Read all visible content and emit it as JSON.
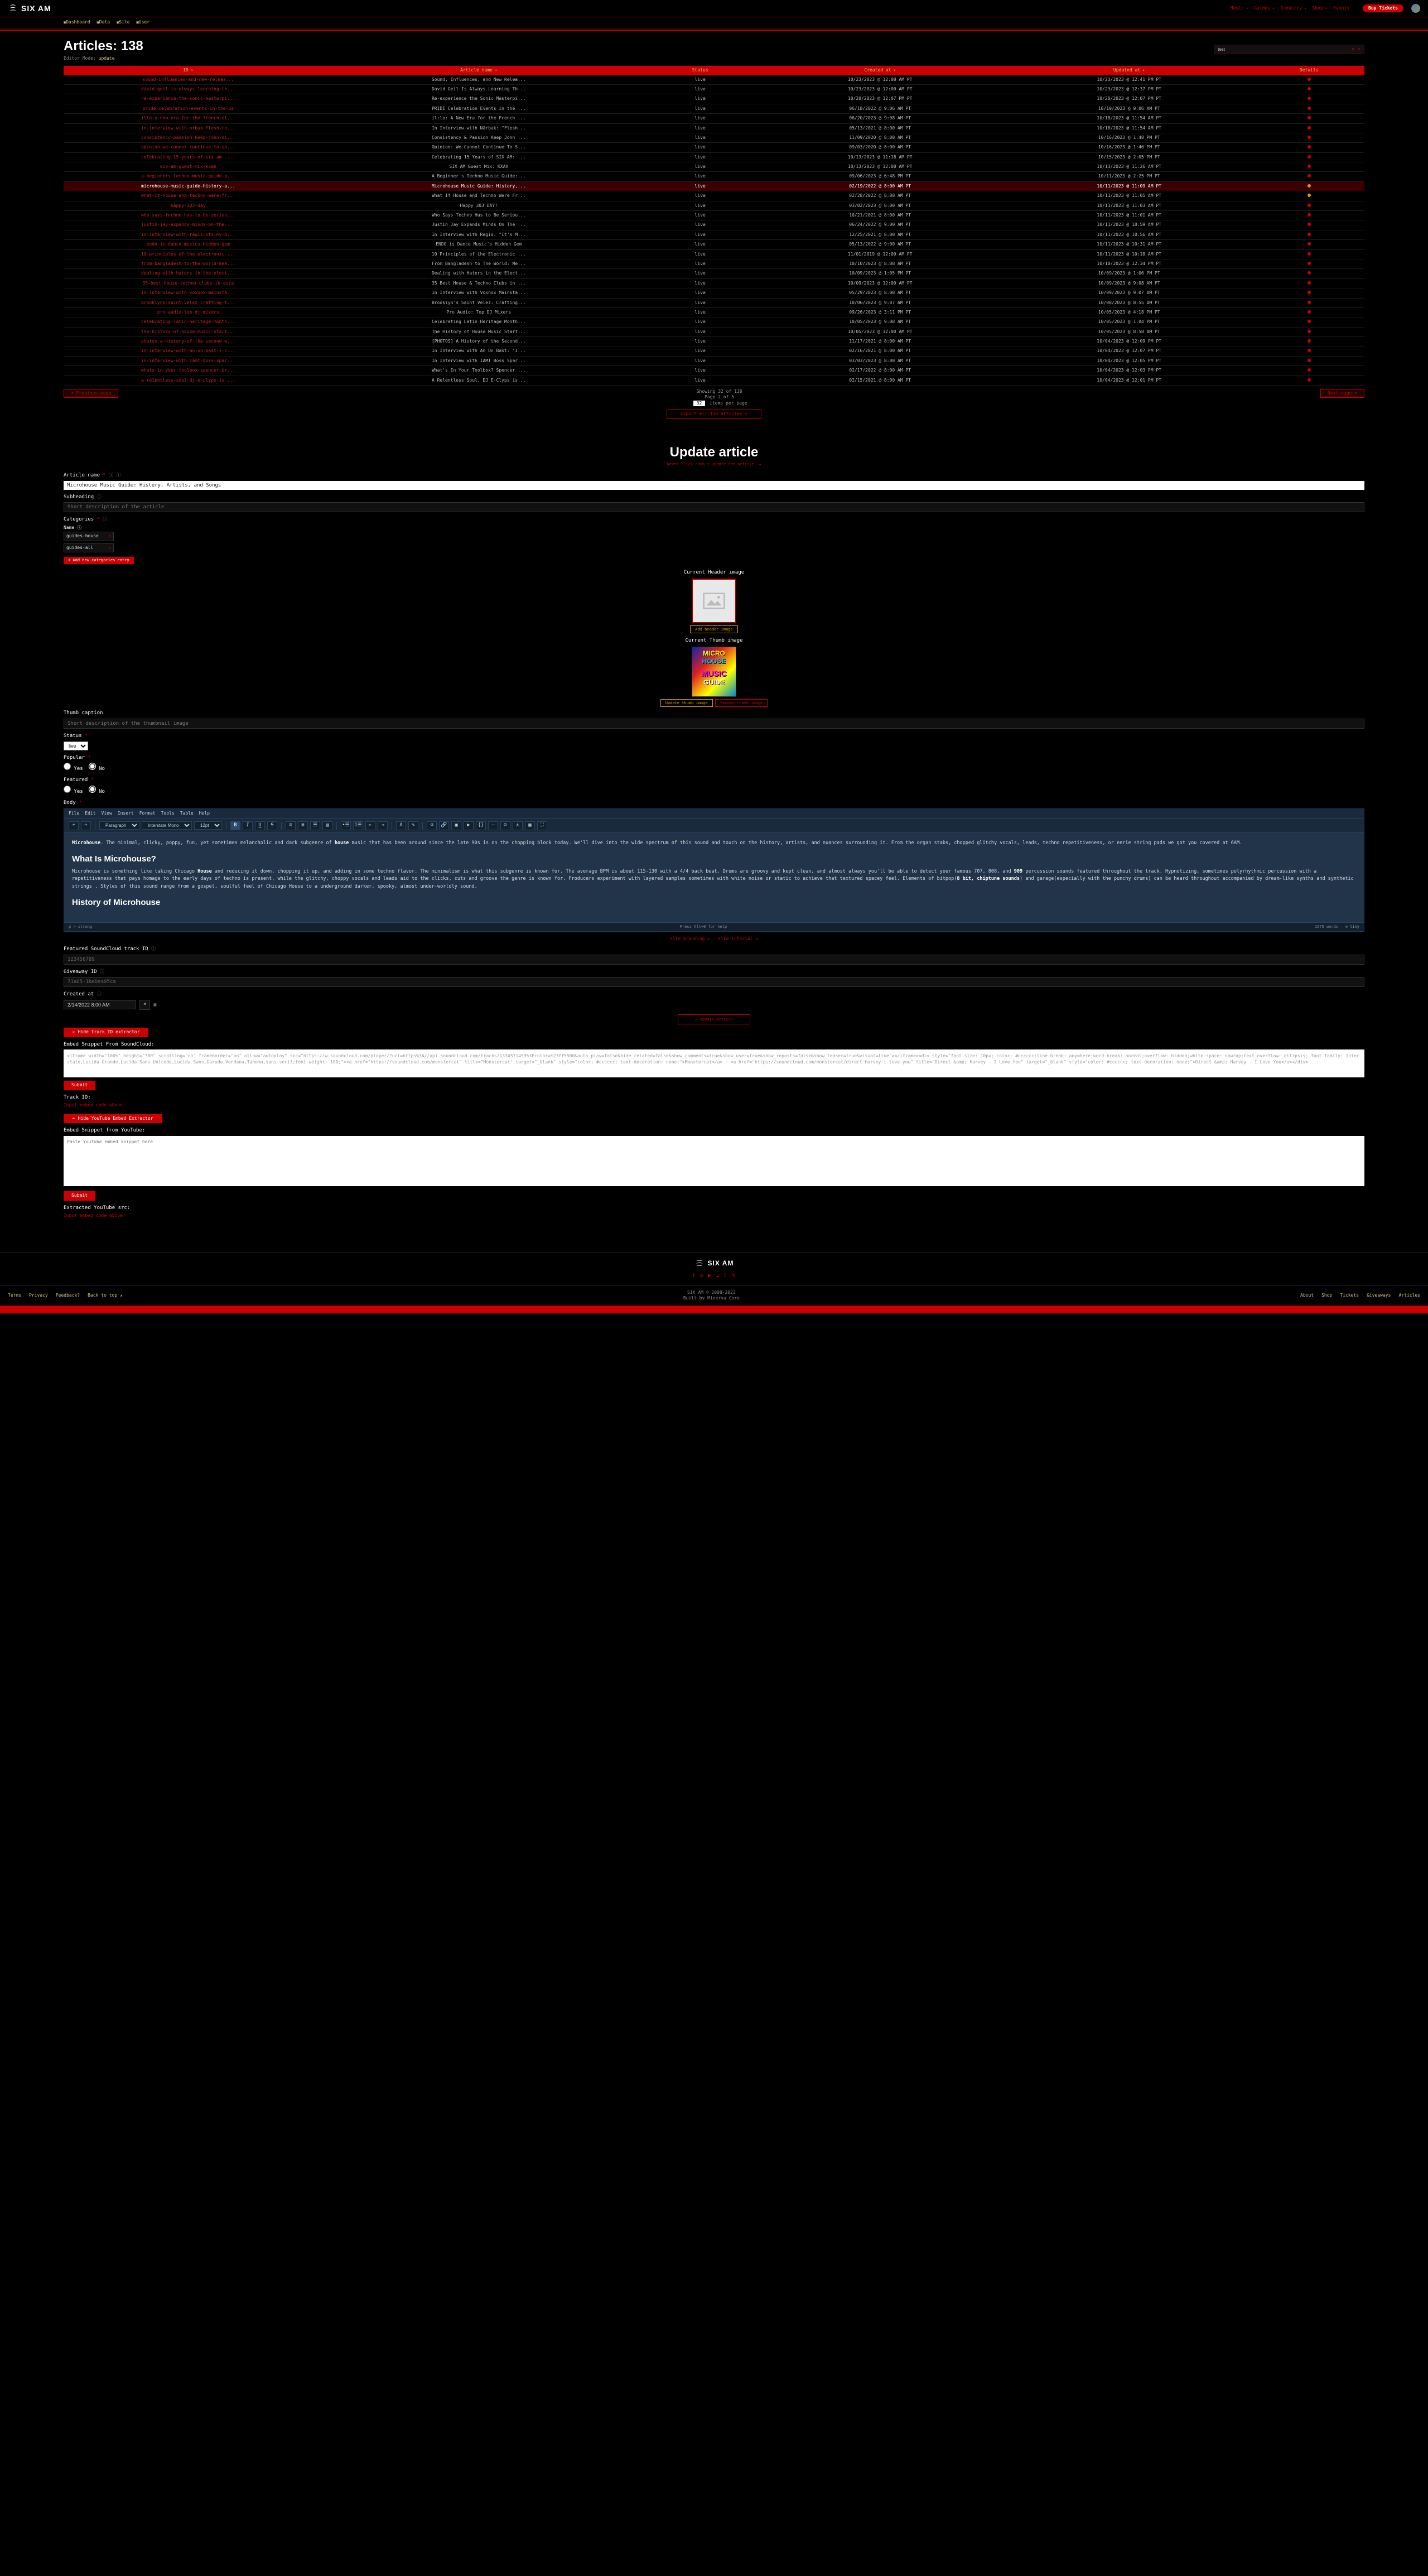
{
  "brand": "SIX AM",
  "topnav": {
    "links": [
      "Music",
      "Guides",
      "Industry",
      "Shop",
      "Events"
    ],
    "buy": "Buy Tickets"
  },
  "subnav": [
    "Dashboard",
    "Data",
    "Site",
    "User"
  ],
  "page": {
    "title": "Articles: 138",
    "editor_mode_label": "Editor Mode:",
    "editor_mode_value": "update",
    "search_value": "test"
  },
  "table": {
    "headers": [
      "ID",
      "Article name",
      "Status",
      "Created at",
      "Updated at",
      "Details"
    ],
    "rows": [
      {
        "id": "sound-influences-and-new-releas...",
        "name": "Sound, Influences, and New Relea...",
        "status": "live",
        "created": "10/23/2023 @ 12:08 AM PT",
        "updated": "10/23/2023 @ 12:41 PM PT",
        "hl": false,
        "dot": "red"
      },
      {
        "id": "david-geil-is-always-learning-th...",
        "name": "David Geil Is Always Learning Th...",
        "status": "live",
        "created": "10/23/2023 @ 12:00 AM PT",
        "updated": "10/23/2023 @ 12:37 PM PT",
        "hl": false,
        "dot": "red"
      },
      {
        "id": "re-experience-the-sonic-masterpi...",
        "name": "Re-experience the Sonic Masterpi...",
        "status": "live",
        "created": "10/20/2023 @ 12:07 PM PT",
        "updated": "10/20/2023 @ 12:07 PM PT",
        "hl": false,
        "dot": "red"
      },
      {
        "id": "pride-celebration-events-in-the-us",
        "name": "PRIDE Celebration Events in the ...",
        "status": "live",
        "created": "06/18/2022 @ 9:06 AM PT",
        "updated": "10/19/2023 @ 9:06 AM PT",
        "hl": false,
        "dot": "red"
      },
      {
        "id": "illo-a-new-era-for-the-french-el...",
        "name": "il:lo: A New Era for the French ...",
        "status": "live",
        "created": "06/20/2023 @ 9:08 AM PT",
        "updated": "10/18/2023 @ 11:54 AM PT",
        "hl": false,
        "dot": "red"
      },
      {
        "id": "in-interview-with-orbak-flesh-to...",
        "name": "In Interview with Närbak: \"Flesh...",
        "status": "live",
        "created": "05/13/2021 @ 8:00 AM PT",
        "updated": "10/18/2023 @ 11:54 AM PT",
        "hl": false,
        "dot": "red"
      },
      {
        "id": "consistency-passion-keep-john-di...",
        "name": "Consistency & Passion Keep John ...",
        "status": "live",
        "created": "11/09/2020 @ 8:00 AM PT",
        "updated": "10/16/2023 @ 1:48 PM PT",
        "hl": false,
        "dot": "red"
      },
      {
        "id": "opinion-we-cannot-continue-to-sa...",
        "name": "Opinion: We Cannot Continue To S...",
        "status": "live",
        "created": "09/03/2020 @ 8:00 AM PT",
        "updated": "10/16/2023 @ 1:46 PM PT",
        "hl": false,
        "dot": "red"
      },
      {
        "id": "celebrating-15-years-of-six-am--...",
        "name": "Celebrating 15 Years of SIX AM: ...",
        "status": "live",
        "created": "10/13/2023 @ 11:18 AM PT",
        "updated": "10/15/2023 @ 2:05 PM PT",
        "hl": false,
        "dot": "red"
      },
      {
        "id": "six-am-guest-mix-kxah",
        "name": "SIX AM Guest Mix: KXAH",
        "status": "live",
        "created": "10/13/2023 @ 12:08 AM PT",
        "updated": "10/13/2023 @ 11:26 AM PT",
        "hl": false,
        "dot": "red"
      },
      {
        "id": "a-beginners-techno-music-guide-b...",
        "name": "A Beginner's Techno Music Guide:...",
        "status": "live",
        "created": "09/06/2023 @ 6:48 PM PT",
        "updated": "10/11/2023 @ 2:25 PM PT",
        "hl": false,
        "dot": "red"
      },
      {
        "id": "microhouse-music-guide-history-a...",
        "name": "Microhouse Music Guide: History,...",
        "status": "live",
        "created": "02/19/2022 @ 8:00 AM PT",
        "updated": "10/11/2023 @ 11:09 AM PT",
        "hl": true,
        "dot": "amber"
      },
      {
        "id": "what-if-house-and-techno-were-fr...",
        "name": "What If House and Techno Were Fr...",
        "status": "live",
        "created": "02/28/2022 @ 8:00 AM PT",
        "updated": "10/11/2023 @ 11:05 AM PT",
        "hl": false,
        "dot": "amber"
      },
      {
        "id": "happy-303-day",
        "name": "Happy 303 DAY!",
        "status": "live",
        "created": "03/02/2023 @ 8:00 AM PT",
        "updated": "10/11/2023 @ 11:03 AM PT",
        "hl": false,
        "dot": "red"
      },
      {
        "id": "who-says-techno-has-to-be-seriou...",
        "name": "Who Says Techno Has to Be Seriou...",
        "status": "live",
        "created": "10/21/2021 @ 8:00 AM PT",
        "updated": "10/11/2023 @ 11:01 AM PT",
        "hl": false,
        "dot": "red"
      },
      {
        "id": "justin-jay-expands-minds-on-the-...",
        "name": "Justin Jay Expands Minds On The ...",
        "status": "live",
        "created": "06/24/2022 @ 9:00 AM PT",
        "updated": "10/11/2023 @ 10:59 AM PT",
        "hl": false,
        "dot": "red"
      },
      {
        "id": "in-interview-with-regis-its-my-d...",
        "name": "In Interview with Regis: \"It's M...",
        "status": "live",
        "created": "12/25/2021 @ 8:00 AM PT",
        "updated": "10/11/2023 @ 10:56 AM PT",
        "hl": false,
        "dot": "red"
      },
      {
        "id": "endo-is-dance-musics-hidden-gem",
        "name": "ENDO is Dance Music's Hidden Gem",
        "status": "live",
        "created": "05/13/2022 @ 9:00 AM PT",
        "updated": "10/11/2023 @ 10:31 AM PT",
        "hl": false,
        "dot": "red"
      },
      {
        "id": "10-principles-of-the-electronic-...",
        "name": "10 Principles of the Electronic ...",
        "status": "live",
        "created": "11/01/2019 @ 12:00 AM PT",
        "updated": "10/11/2023 @ 10:18 AM PT",
        "hl": false,
        "dot": "red"
      },
      {
        "id": "from-bangladesh-to-the-world-mee...",
        "name": "From Bangladesh to The World: Me...",
        "status": "live",
        "created": "10/10/2023 @ 8:08 AM PT",
        "updated": "10/10/2023 @ 12:34 PM PT",
        "hl": false,
        "dot": "red"
      },
      {
        "id": "dealing-with-haters-in-the-elect...",
        "name": "Dealing with Haters in the Elect...",
        "status": "live",
        "created": "10/09/2023 @ 1:05 PM PT",
        "updated": "10/09/2023 @ 1:06 PM PT",
        "hl": false,
        "dot": "red"
      },
      {
        "id": "35-best-house-techno-clubs-in-asia",
        "name": "35 Best House & Techno Clubs in ...",
        "status": "live",
        "created": "10/09/2023 @ 12:00 AM PT",
        "updated": "10/09/2023 @ 9:08 AM PT",
        "hl": false,
        "dot": "red"
      },
      {
        "id": "in-interview-with-voxnox-mainsta...",
        "name": "In Interview with Voxnox Mainsta...",
        "status": "live",
        "created": "05/29/2023 @ 8:08 AM PT",
        "updated": "10/09/2023 @ 9:07 AM PT",
        "hl": false,
        "dot": "red"
      },
      {
        "id": "brooklyns-saint-velez-crafting-t...",
        "name": "Brooklyn's Saint Velez: Crafting...",
        "status": "live",
        "created": "10/06/2023 @ 9:07 AM PT",
        "updated": "10/08/2023 @ 8:55 AM PT",
        "hl": false,
        "dot": "red"
      },
      {
        "id": "pro-audio-top-dj-mixers",
        "name": "Pro Audio: Top DJ Mixers",
        "status": "live",
        "created": "09/26/2023 @ 3:11 PM PT",
        "updated": "10/05/2023 @ 4:18 PM PT",
        "hl": false,
        "dot": "red"
      },
      {
        "id": "celebrating-latin-heritage-month...",
        "name": "Celebrating Latin Heritage Month...",
        "status": "live",
        "created": "10/05/2023 @ 9:08 AM PT",
        "updated": "10/05/2023 @ 1:04 PM PT",
        "hl": false,
        "dot": "red"
      },
      {
        "id": "the-history-of-house-music-start...",
        "name": "The History of House Music Start...",
        "status": "live",
        "created": "10/05/2023 @ 12:00 AM PT",
        "updated": "10/05/2023 @ 8:58 AM PT",
        "hl": false,
        "dot": "red"
      },
      {
        "id": "photos-a-history-of-the-second-w...",
        "name": "[PHOTOS] A History of the Second...",
        "status": "live",
        "created": "11/17/2021 @ 8:00 AM PT",
        "updated": "10/04/2023 @ 12:09 PM PT",
        "hl": false,
        "dot": "red"
      },
      {
        "id": "in-interview-with-an-on-bast-i-c...",
        "name": "In Interview with An On Bast: \"I...",
        "status": "live",
        "created": "02/16/2021 @ 8:00 AM PT",
        "updated": "10/04/2023 @ 12:07 PM PT",
        "hl": false,
        "dot": "red"
      },
      {
        "id": "in-interview-with-iamt-boss-spar...",
        "name": "In Interview with IAMT Boss Spar...",
        "status": "live",
        "created": "03/03/2023 @ 8:00 AM PT",
        "updated": "10/04/2023 @ 12:05 PM PT",
        "hl": false,
        "dot": "red"
      },
      {
        "id": "whats-in-your-toolbox-spencer-br...",
        "name": "What's In Your Toolbox? Spencer ...",
        "status": "live",
        "created": "02/17/2022 @ 8:00 AM PT",
        "updated": "10/04/2023 @ 12:03 PM PT",
        "hl": false,
        "dot": "red"
      },
      {
        "id": "a-relentless-soul-dj-e-clyps-is-...",
        "name": "A Relentless Soul, DJ E-Clyps is...",
        "status": "live",
        "created": "02/15/2021 @ 8:00 AM PT",
        "updated": "10/04/2023 @ 12:01 PM PT",
        "hl": false,
        "dot": "red"
      }
    ]
  },
  "pager": {
    "prev": "< Previous page",
    "next": "Next page >",
    "showing": "Showing 32 of 138",
    "page": "Page 2 of 5",
    "per_val": "32",
    "per_label": "items per page",
    "export": "Export all 138 articles >"
  },
  "form": {
    "title": "Update article",
    "warn": "Never click 'don't update the article' →",
    "labels": {
      "name": "Article name",
      "subheading": "Subheading",
      "categories": "Categories",
      "cat_name": "Name",
      "header_img": "Current Header image",
      "thumb_img": "Current Thumb image",
      "thumb_caption": "Thumb caption",
      "status": "Status",
      "popular": "Popular",
      "featured": "Featured",
      "body": "Body",
      "sc_id": "Featured SoundCloud track ID",
      "giveaway": "Giveaway ID",
      "created_at": "Created at",
      "embed_sc": "Embed Snippet From SoundCloud:",
      "track_id": "Track ID:",
      "embed_yt": "Embed Snippet from YouTube:",
      "extracted_yt": "Extracted YouTube src:"
    },
    "values": {
      "name": "Microhouse Music Guide: History, Artists, and Songs",
      "subheading_ph": "Short description of the article",
      "categories": [
        "guides-house",
        "guides-all"
      ],
      "add_cat": "+ Add new categories entry",
      "add_header": "Add header image",
      "update_thumb": "Update thumb image",
      "remove_thumb": "Remove thumb image",
      "thumb_caption_ph": "Short description of the thumbnail image",
      "status": "live",
      "yes": "Yes",
      "no": "No",
      "sc_id": "123456789",
      "giveaway": "71a05-1beDea05ca",
      "created_date": "2/14/2022 8:00 AM",
      "created_tz": "×",
      "update_btn": "← Update article",
      "hide_sc_btn": "← Hide track ID extractor",
      "hide_yt_btn": "← Hide YouTube Embed Extractor",
      "submit": "Submit",
      "track_id_msg": "Input embed code above!",
      "yt_msg": "Input embed code above!",
      "yt_ph": "Paste YouTube embed snippet here",
      "site_branding": "site branding >",
      "site_tutorial": "site tutorial >"
    },
    "editor": {
      "menubar": [
        "File",
        "Edit",
        "View",
        "Insert",
        "Format",
        "Tools",
        "Table",
        "Help"
      ],
      "para": "Paragraph",
      "font": "Interstate Mono",
      "size": "12pt",
      "body_intro_b": "Microhouse",
      "body_intro": ". The minimal, clicky, poppy, fun, yet sometimes melancholic and dark subgenre of ",
      "body_intro_b2": "house",
      "body_intro2": " music that has been around since the late 90s is on the chopping block today. We'll dive into the wide spectrum of this sound and touch on the history, artists, and nuances surrounding it. From the organ stabs, chopped glitchy vocals, leads, techno repetitiveness, or eerie string pads we got you covered at 6AM.",
      "h1": "What Is Microhouse?",
      "p2a": "Microhouse is something like taking Chicago ",
      "p2b": "House",
      "p2c": " and reducing it down, chopping it up, and adding in some techno flavor.  The minimalism is what this subgenre is known for. The average BPM is about 115-130 with a 4/4 back beat. Drums are groovy and kept clean, and almost always you'll be able to detect your famous 707, 808, and ",
      "p2d": "909",
      "p2e": " percussion sounds featured throughout the track. Hypnotizing, sometimes polyrhythmic percussion with a repetitiveness that pays homage to the early days of techno is present, while the glitchy, choppy vocals and leads aid to the clicks, cuts and groove the genre is known for. Producers experiment with layered samples sometimes with white noise or static to achieve that textured spacey feel. Elements of bitpop(",
      "p2f": "8 bit, chiptune sounds",
      "p2g": ") and garage(especially with the punchy drums) can be heard throughout accompanied by dream-like synths and synthetic strings . Styles of this sound range from a gospel, soulful feel of Chicago House to a underground darker, spooky, almost under-worldly sound.",
      "h2": "History of Microhouse",
      "footer_left": "p > strong",
      "footer_hint": "Press Alt+0 for help",
      "footer_words": "1575 words",
      "footer_tiny": "tiny"
    },
    "embed_sc_text": "<iframe width=\"100%\" height=\"300\" scrolling=\"no\" frameborder=\"no\" allow=\"autoplay\" src=\"https://w.soundcloud.com/player/?url=https%3A//api.soundcloud.com/tracks/1334571459%3Fcolor=%23ff5500&auto_play=false&hide_related=false&show_comments=true&show_user=true&show_reposts=false&show_teaser=true&visual=true\"></iframe><div style=\"font-size: 10px; color: #cccccc;line-break: anywhere;word-break: normal;overflow: hidden;white-space: nowrap;text-overflow: ellipsis; font-family: Interstate,Lucida Grande,Lucida Sans Unicode,Lucida Sans,Garuda,Verdana,Tahoma,sans-serif;font-weight: 100;\"><a href=\"https://soundcloud.com/monstercat\" title=\"Monstercat\" target=\"_blank\" style=\"color: #cccccc; text-decoration: none;\">Monstercat</a> · <a href=\"https://soundcloud.com/monstercat/direct-harvey-i-love-you\" title=\"Direct &amp; Harvey - I Love You\" target=\"_blank\" style=\"color: #cccccc; text-decoration: none;\">Direct &amp; Harvey - I Love You</a></div>"
  },
  "footer": {
    "left": [
      "Terms",
      "Privacy",
      "Feedback?",
      "Back to top ▴"
    ],
    "mid1": "SIX AM © 2008-2023",
    "mid2": "Built by Minerva Core",
    "right": [
      "About",
      "Shop",
      "Tickets",
      "Giveaways",
      "Articles"
    ]
  }
}
